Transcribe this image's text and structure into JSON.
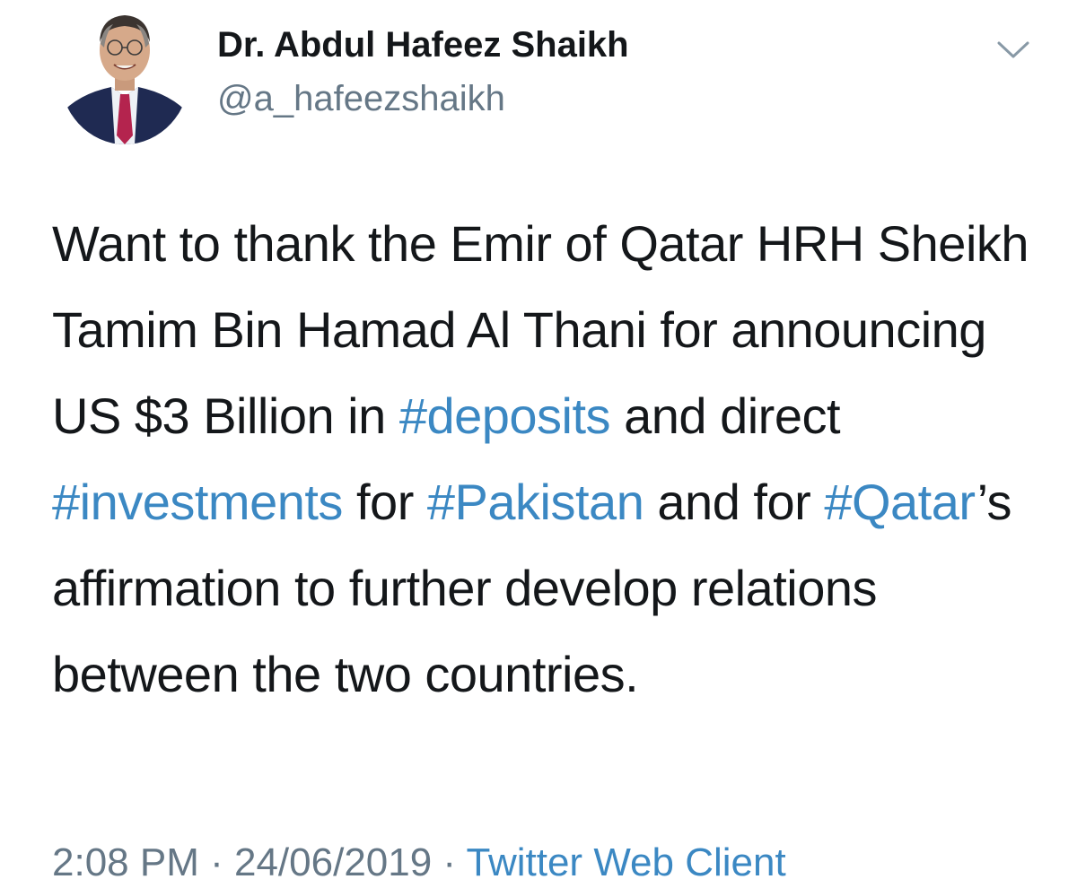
{
  "author": {
    "display_name": "Dr. Abdul Hafeez Shaikh",
    "handle": "@a_hafeezshaikh",
    "avatar_icon": "profile-photo"
  },
  "menu": {
    "icon": "chevron-down-icon"
  },
  "tweet": {
    "segments": {
      "s1": "Want to thank the Emir of Qatar HRH Sheikh Tamim Bin Hamad Al Thani for announcing US $3 Billion in ",
      "h1": "#deposits",
      "s2": " and direct ",
      "h2": "#investments",
      "s3": " for ",
      "h3": "#Pakistan",
      "s4": " and for ",
      "h4": "#Qatar",
      "s5": "’s affirmation to further develop relations between the two countries."
    }
  },
  "meta": {
    "time": "2:08 PM",
    "separator1": " · ",
    "date": "24/06/2019",
    "separator2": " · ",
    "source": "Twitter Web Client"
  },
  "colors": {
    "text": "#14171a",
    "secondary": "#657786",
    "link": "#3b88c3",
    "background": "#ffffff"
  }
}
